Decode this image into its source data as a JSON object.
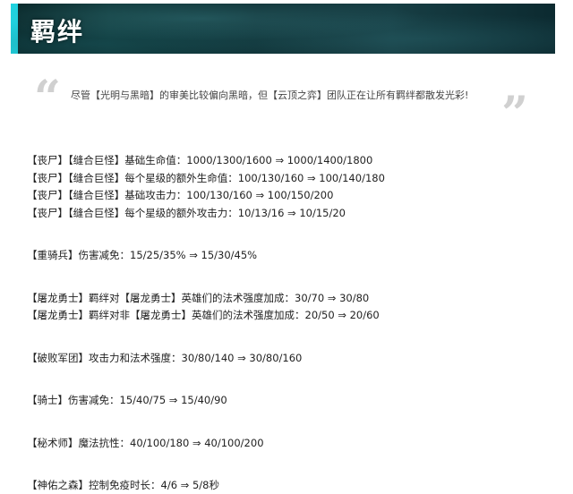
{
  "banner": {
    "title": "羁绊"
  },
  "quote": {
    "open_mark": "“",
    "close_mark": "”",
    "text": "尽管【光明与黑暗】的审美比较偏向黑暗，但【云顶之弈】团队正在让所有羁绊都散发光彩!"
  },
  "groups": [
    {
      "lines": [
        "【丧尸】【缝合巨怪】基础生命值：1000/1300/1600 ⇒ 1000/1400/1800",
        "【丧尸】【缝合巨怪】每个星级的额外生命值：100/130/160 ⇒ 100/140/180",
        "【丧尸】【缝合巨怪】基础攻击力：100/130/160 ⇒ 100/150/200",
        "【丧尸】【缝合巨怪】每个星级的额外攻击力：10/13/16 ⇒ 10/15/20"
      ]
    },
    {
      "lines": [
        "【重骑兵】伤害减免：15/25/35% ⇒ 15/30/45%"
      ]
    },
    {
      "lines": [
        "【屠龙勇士】羁绊对【屠龙勇士】英雄们的法术强度加成：30/70 ⇒ 30/80",
        "【屠龙勇士】羁绊对非【屠龙勇士】英雄们的法术强度加成：20/50 ⇒ 20/60"
      ]
    },
    {
      "lines": [
        "【破败军团】攻击力和法术强度：30/80/140 ⇒ 30/80/160"
      ]
    },
    {
      "lines": [
        "【骑士】伤害减免：15/40/75 ⇒ 15/40/90"
      ]
    },
    {
      "lines": [
        "【秘术师】魔法抗性：40/100/180 ⇒ 40/100/200"
      ]
    },
    {
      "lines": [
        "【神佑之森】控制免疫时长：4/6 ⇒ 5/8秒"
      ]
    }
  ]
}
